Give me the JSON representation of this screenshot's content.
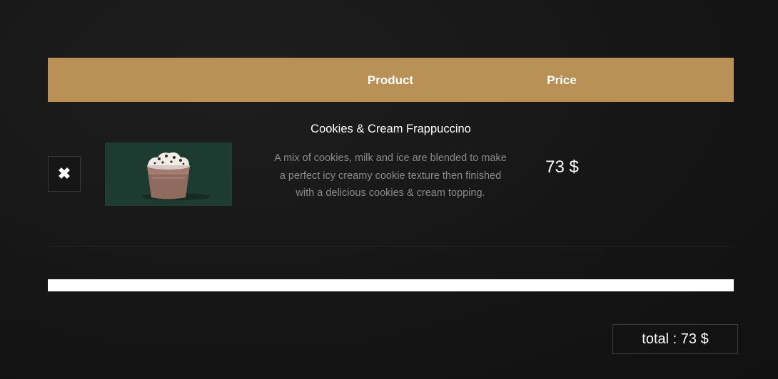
{
  "cart": {
    "columns": {
      "product": "Product",
      "price": "Price"
    },
    "items": [
      {
        "remove_icon": "close-icon",
        "image_alt": "frappuccino-image",
        "name": "Cookies & Cream Frappuccino",
        "description": "A mix of cookies, milk and ice are blended to make a perfect icy creamy cookie texture then finished with a delicious cookies & cream topping.",
        "price": "73 $"
      }
    ],
    "total": "total : 73 $"
  },
  "colors": {
    "header_bg": "#b99157",
    "page_bg": "#161616",
    "thumb_bg": "#1d3b30"
  }
}
